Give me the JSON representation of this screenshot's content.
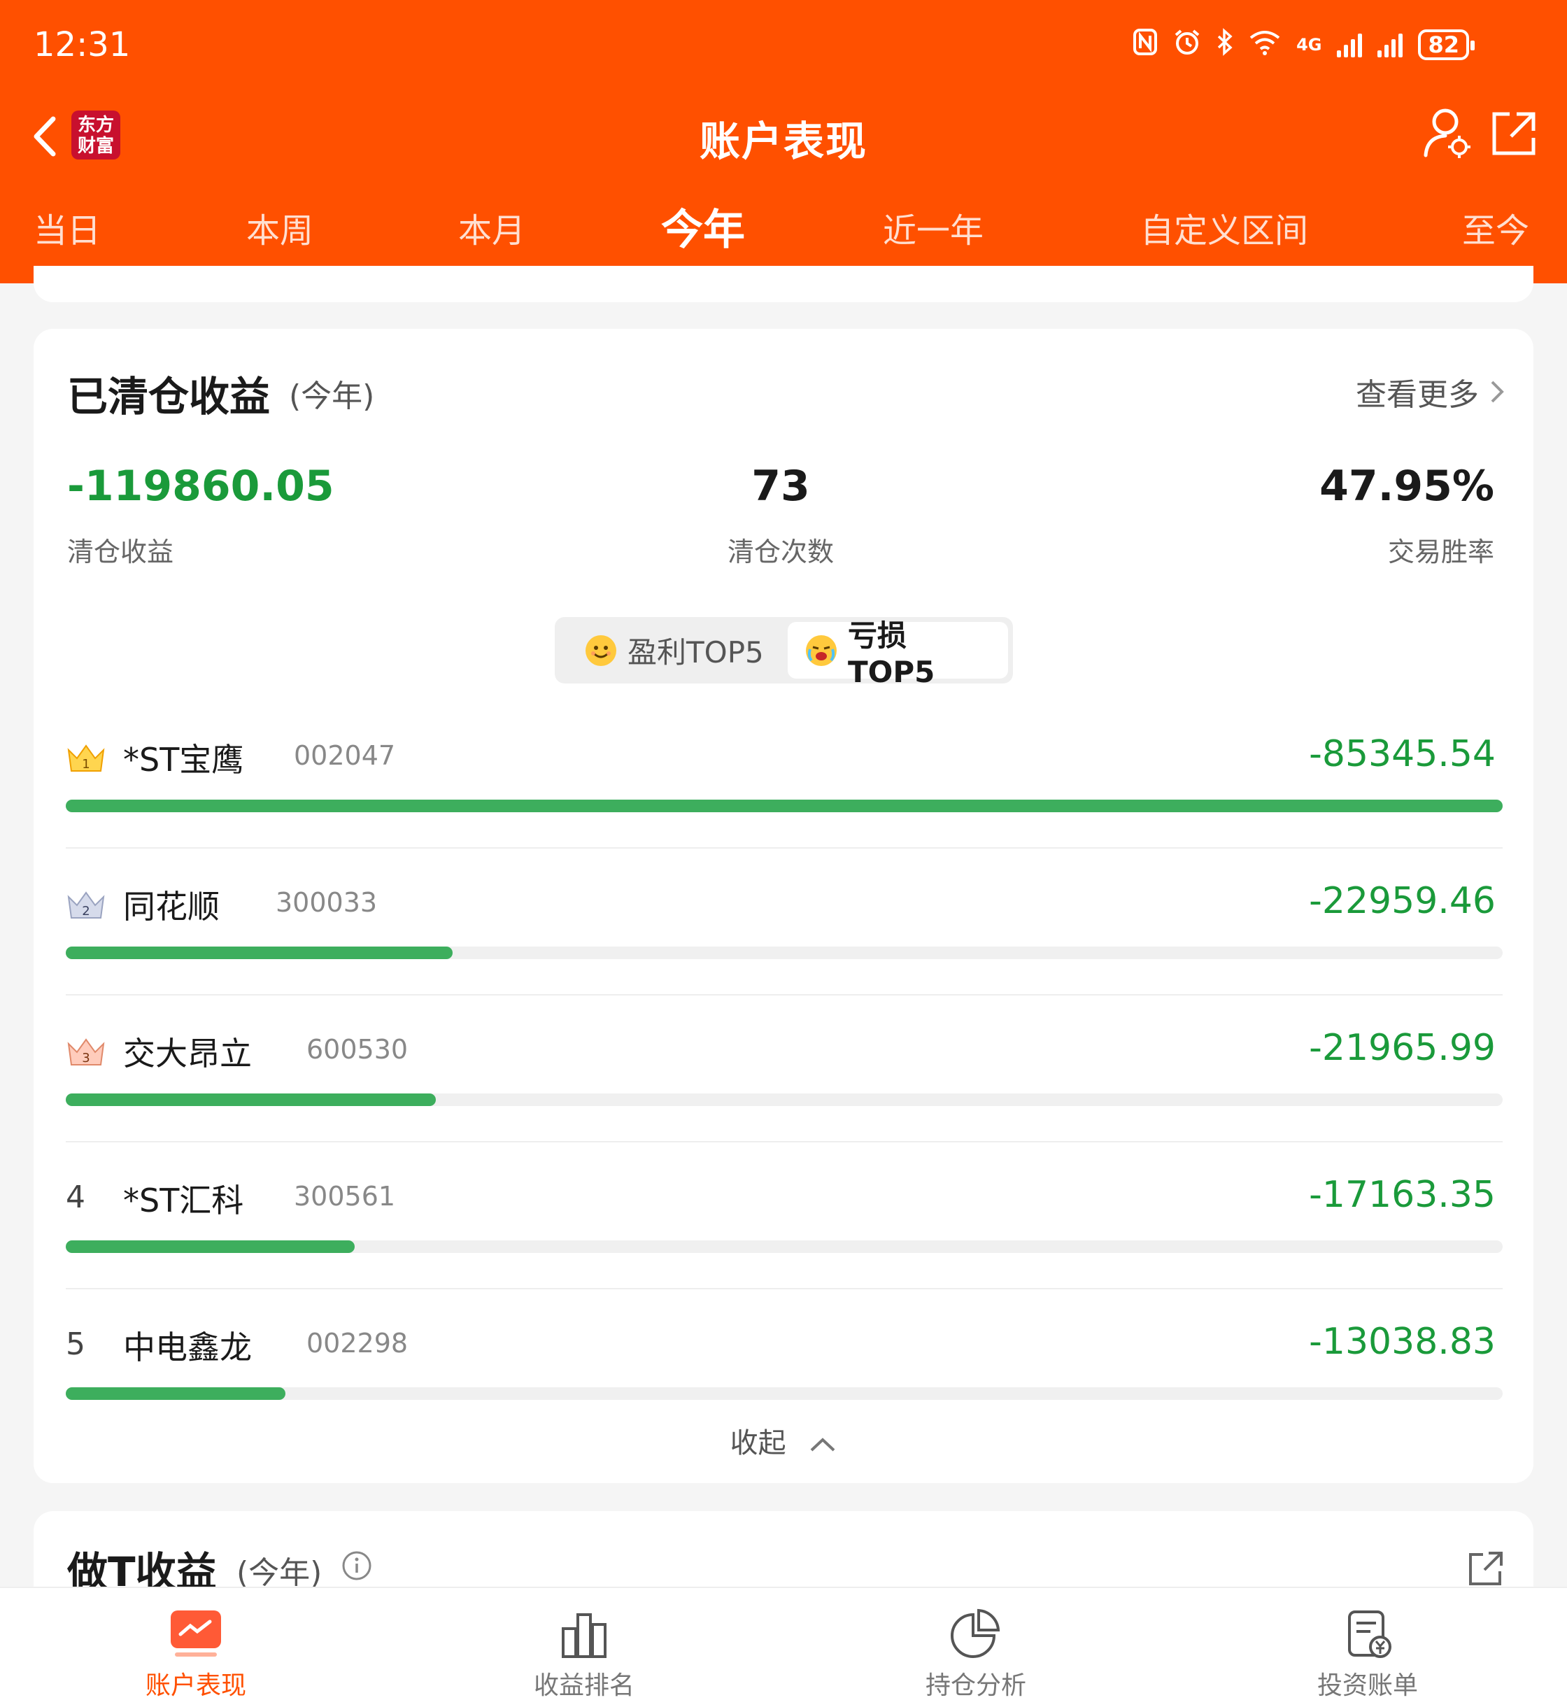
{
  "status_bar": {
    "time": "12:31",
    "network": "4G",
    "battery": "82"
  },
  "nav": {
    "title": "账户表现",
    "logo_line1": "东方",
    "logo_line2": "财富"
  },
  "tabs": [
    {
      "label": "当日"
    },
    {
      "label": "本周"
    },
    {
      "label": "本月"
    },
    {
      "label": "今年",
      "active": true
    },
    {
      "label": "近一年"
    },
    {
      "label": "自定义区间"
    },
    {
      "label": "至今"
    }
  ],
  "cleared_card": {
    "title": "已清仓收益",
    "subtitle": "(今年)",
    "see_more": "查看更多",
    "stats": [
      {
        "value": "-119860.05",
        "label": "清仓收益"
      },
      {
        "value": "73",
        "label": "清仓次数"
      },
      {
        "value": "47.95%",
        "label": "交易胜率"
      }
    ],
    "toggle": {
      "profit_label": "盈利TOP5",
      "loss_label": "亏损TOP5",
      "selected": "亏损TOP5"
    },
    "rankings": [
      {
        "rank": "1",
        "name": "*ST宝鹰",
        "code": "002047",
        "value": "-85345.54",
        "abs": 85345.54
      },
      {
        "rank": "2",
        "name": "同花顺",
        "code": "300033",
        "value": "-22959.46",
        "abs": 22959.46
      },
      {
        "rank": "3",
        "name": "交大昂立",
        "code": "600530",
        "value": "-21965.99",
        "abs": 21965.99
      },
      {
        "rank": "4",
        "name": "*ST汇科",
        "code": "300561",
        "value": "-17163.35",
        "abs": 17163.35
      },
      {
        "rank": "5",
        "name": "中电鑫龙",
        "code": "002298",
        "value": "-13038.83",
        "abs": 13038.83
      }
    ],
    "collapse_label": "收起"
  },
  "t_card": {
    "title": "做T收益",
    "subtitle": "(今年)"
  },
  "bottom_nav": [
    {
      "label": "账户表现",
      "active": true
    },
    {
      "label": "收益排名"
    },
    {
      "label": "持仓分析"
    },
    {
      "label": "投资账单"
    }
  ],
  "colors": {
    "brand": "#ff5000",
    "loss": "#1a9a3a",
    "bar": "#3dae5d"
  }
}
